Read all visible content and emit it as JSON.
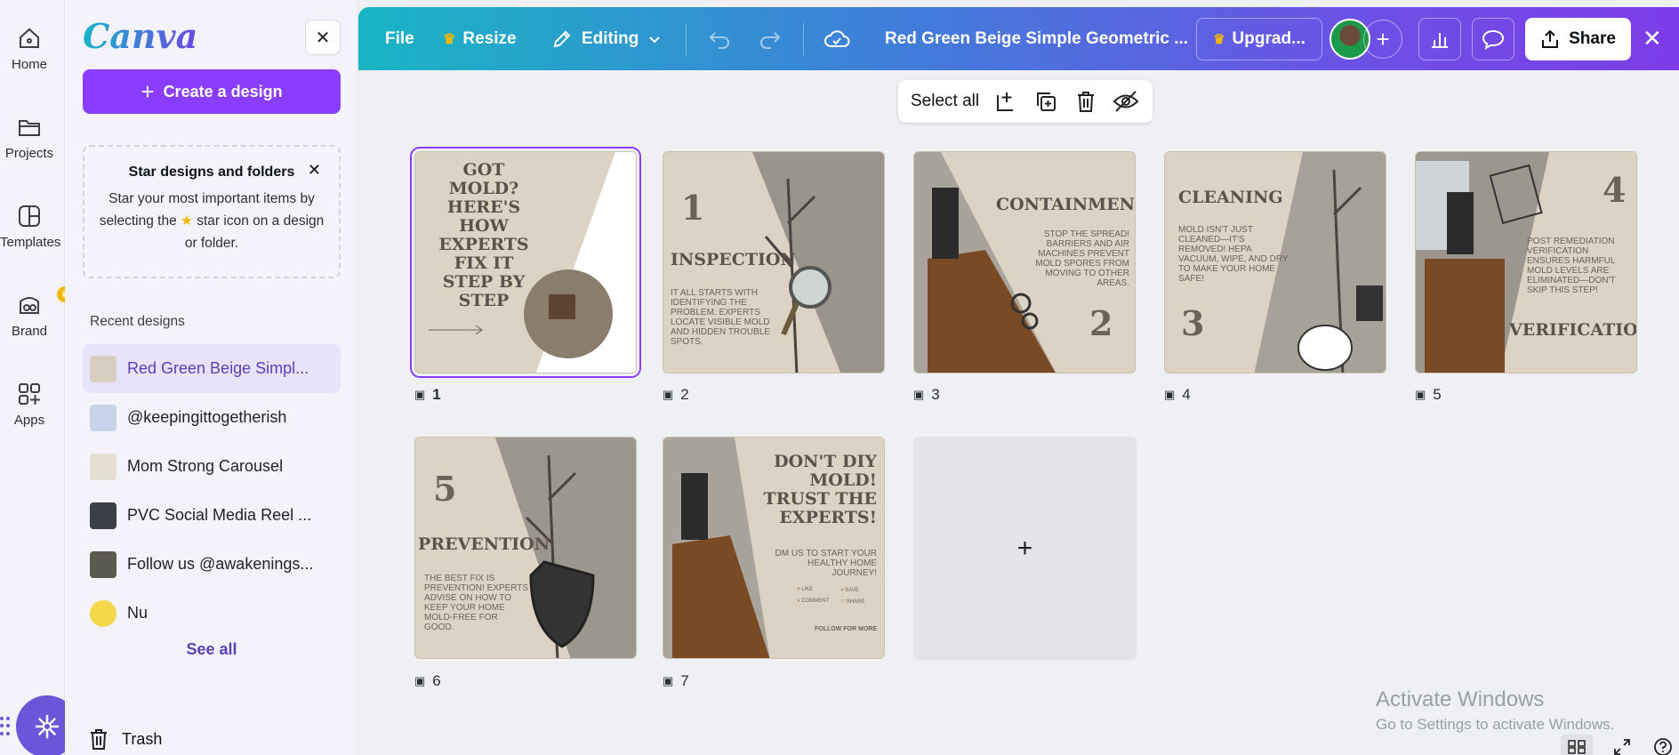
{
  "rail": {
    "items": [
      {
        "label": "Home",
        "icon": "home-icon"
      },
      {
        "label": "Projects",
        "icon": "folder-icon"
      },
      {
        "label": "Templates",
        "icon": "templates-icon"
      },
      {
        "label": "Brand",
        "icon": "brand-icon"
      },
      {
        "label": "Apps",
        "icon": "apps-icon"
      }
    ]
  },
  "panel": {
    "logo": "Canva",
    "create_label": "Create a design",
    "star_card": {
      "title": "Star designs and folders",
      "text_before": "Star your most important items by selecting the",
      "text_after": "star icon on a design or folder."
    },
    "recent_heading": "Recent designs",
    "recent": [
      {
        "name": "Red Green Beige Simpl...",
        "thumb": "#d8cfc0"
      },
      {
        "name": "@keepingittogetherish",
        "thumb": "#c8d4ea"
      },
      {
        "name": "Mom Strong Carousel",
        "thumb": "#e6e0d4"
      },
      {
        "name": "PVC Social Media Reel ...",
        "thumb": "#3a3f48"
      },
      {
        "name": "Follow us @awakenings...",
        "thumb": "#5a5a4e"
      },
      {
        "name": "Nu",
        "thumb": "#f2d84a"
      }
    ],
    "see_all": "See all",
    "trash": "Trash"
  },
  "topbar": {
    "file": "File",
    "resize": "Resize",
    "editing": "Editing",
    "title": "Red Green Beige Simple Geometric ...",
    "upgrade": "Upgrad...",
    "share": "Share"
  },
  "floatbar": {
    "select_all": "Select all"
  },
  "pages": [
    {
      "num": "1",
      "headline": "GOT MOLD? HERE'S HOW EXPERTS FIX IT STEP BY STEP"
    },
    {
      "num": "2",
      "step": "1",
      "headline": "INSPECTION",
      "body": "IT ALL STARTS WITH IDENTIFYING THE PROBLEM. EXPERTS LOCATE VISIBLE MOLD AND HIDDEN TROUBLE SPOTS."
    },
    {
      "num": "3",
      "step": "2",
      "headline": "CONTAINMENT",
      "body": "STOP THE SPREAD! BARRIERS AND AIR MACHINES PREVENT MOLD SPORES FROM MOVING TO OTHER AREAS."
    },
    {
      "num": "4",
      "step": "3",
      "headline": "CLEANING",
      "body": "MOLD ISN'T JUST CLEANED—IT'S REMOVED! HEPA VACUUM, WIPE, AND DRY TO MAKE YOUR HOME SAFE!"
    },
    {
      "num": "5",
      "step": "4",
      "headline": "VERIFICATION",
      "body": "POST REMEDIATION VERIFICATION ENSURES HARMFUL MOLD LEVELS ARE ELIMINATED—DON'T SKIP THIS STEP!"
    },
    {
      "num": "6",
      "step": "5",
      "headline": "PREVENTION",
      "body": "THE BEST FIX IS PREVENTION! EXPERTS ADVISE ON HOW TO KEEP YOUR HOME MOLD-FREE FOR GOOD."
    },
    {
      "num": "7",
      "headline": "DON'T DIY MOLD! TRUST THE EXPERTS!",
      "body": "DM US TO START YOUR HEALTHY HOME JOURNEY!",
      "actions": [
        "LIKE",
        "SAVE",
        "COMMENT",
        "SHARE"
      ],
      "footer": "FOLLOW FOR MORE"
    }
  ],
  "watermark": {
    "line1": "Activate Windows",
    "line2": "Go to Settings to activate Windows."
  },
  "colors": {
    "accent": "#8b3dff",
    "beige": "#dcd3c4",
    "text_brown": "#5b534b"
  }
}
